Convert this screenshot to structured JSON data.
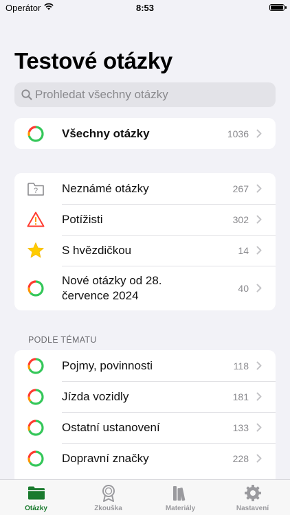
{
  "status": {
    "carrier": "Operátor",
    "time": "8:53"
  },
  "title": "Testové otázky",
  "search": {
    "placeholder": "Prohledat všechny otázky"
  },
  "all_row": {
    "label": "Všechny otázky",
    "count": "1036",
    "icon": "progress-ring-icon"
  },
  "groups": [
    {
      "label": "Neznámé otázky",
      "count": "267",
      "icon": "unknown-folder-icon"
    },
    {
      "label": "Potížisti",
      "count": "302",
      "icon": "warning-icon"
    },
    {
      "label": "S hvězdičkou",
      "count": "14",
      "icon": "star-icon"
    },
    {
      "label": "Nové otázky od 28. července 2024",
      "line1": "Nové otázky od 28.",
      "line2": "července 2024",
      "count": "40",
      "icon": "progress-ring-icon"
    }
  ],
  "topics_header": "PODLE TÉMATU",
  "topics": [
    {
      "label": "Pojmy, povinnosti",
      "count": "118"
    },
    {
      "label": "Jízda vozidly",
      "count": "181"
    },
    {
      "label": "Ostatní ustanovení",
      "count": "133"
    },
    {
      "label": "Dopravní značky",
      "count": "228"
    }
  ],
  "tabs": [
    {
      "label": "Otázky",
      "icon": "folder-icon",
      "active": true
    },
    {
      "label": "Zkouška",
      "icon": "badge-icon",
      "active": false
    },
    {
      "label": "Materiály",
      "icon": "books-icon",
      "active": false
    },
    {
      "label": "Nastavení",
      "icon": "gear-icon",
      "active": false
    }
  ],
  "colors": {
    "accent": "#1a7a2e",
    "ring_green": "#34c759",
    "ring_red": "#ff3b30",
    "ring_orange": "#ff9500",
    "star": "#ffcc00"
  }
}
